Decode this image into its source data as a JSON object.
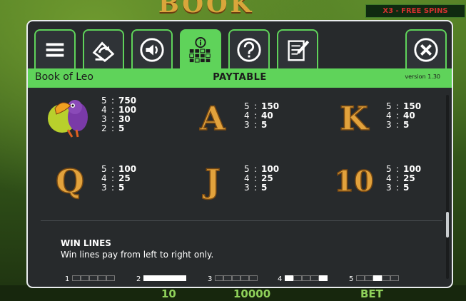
{
  "background": {
    "game_logo": "BOOK LEO",
    "free_spins_label": "X3 - FREE SPINS",
    "bottom_values": [
      "10",
      "10000",
      "BET"
    ]
  },
  "tabs": [
    {
      "name": "menu",
      "icon": "hamburger-icon"
    },
    {
      "name": "autoplay",
      "icon": "autoplay-icon"
    },
    {
      "name": "sound",
      "icon": "speaker-icon"
    },
    {
      "name": "paytable",
      "icon": "info-grid-icon",
      "active": true
    },
    {
      "name": "help",
      "icon": "question-icon"
    },
    {
      "name": "history",
      "icon": "notepad-icon"
    },
    {
      "name": "close",
      "icon": "close-icon"
    }
  ],
  "header": {
    "game_name": "Book of Leo",
    "title": "PAYTABLE",
    "version": "version 1.30"
  },
  "colors": {
    "accent_green": "#5fd35a",
    "panel_bg": "#272a2c",
    "symbol_gold": "#e2a23c"
  },
  "paytable": [
    {
      "symbol": "toucan",
      "glyph": "",
      "pays": [
        {
          "n": "5",
          "v": "750"
        },
        {
          "n": "4",
          "v": "100"
        },
        {
          "n": "3",
          "v": "30"
        },
        {
          "n": "2",
          "v": "5"
        }
      ]
    },
    {
      "symbol": "A",
      "glyph": "A",
      "pays": [
        {
          "n": "5",
          "v": "150"
        },
        {
          "n": "4",
          "v": "40"
        },
        {
          "n": "3",
          "v": "5"
        }
      ]
    },
    {
      "symbol": "K",
      "glyph": "K",
      "pays": [
        {
          "n": "5",
          "v": "150"
        },
        {
          "n": "4",
          "v": "40"
        },
        {
          "n": "3",
          "v": "5"
        }
      ]
    },
    {
      "symbol": "Q",
      "glyph": "Q",
      "pays": [
        {
          "n": "5",
          "v": "100"
        },
        {
          "n": "4",
          "v": "25"
        },
        {
          "n": "3",
          "v": "5"
        }
      ]
    },
    {
      "symbol": "J",
      "glyph": "J",
      "pays": [
        {
          "n": "5",
          "v": "100"
        },
        {
          "n": "4",
          "v": "25"
        },
        {
          "n": "3",
          "v": "5"
        }
      ]
    },
    {
      "symbol": "10",
      "glyph": "10",
      "pays": [
        {
          "n": "5",
          "v": "100"
        },
        {
          "n": "4",
          "v": "25"
        },
        {
          "n": "3",
          "v": "5"
        }
      ]
    }
  ],
  "win_lines": {
    "title": "WIN LINES",
    "description": "Win lines pay from left to right only.",
    "lines": [
      {
        "num": "1",
        "cells": [
          0,
          0,
          0,
          0,
          0
        ]
      },
      {
        "num": "2",
        "cells": [
          1,
          1,
          1,
          1,
          1
        ]
      },
      {
        "num": "3",
        "cells": [
          0,
          0,
          0,
          0,
          0
        ]
      },
      {
        "num": "4",
        "cells": [
          1,
          0,
          0,
          0,
          1
        ]
      },
      {
        "num": "5",
        "cells": [
          0,
          0,
          1,
          0,
          0
        ]
      }
    ]
  },
  "scroll": {
    "position_fraction": 0.74
  }
}
